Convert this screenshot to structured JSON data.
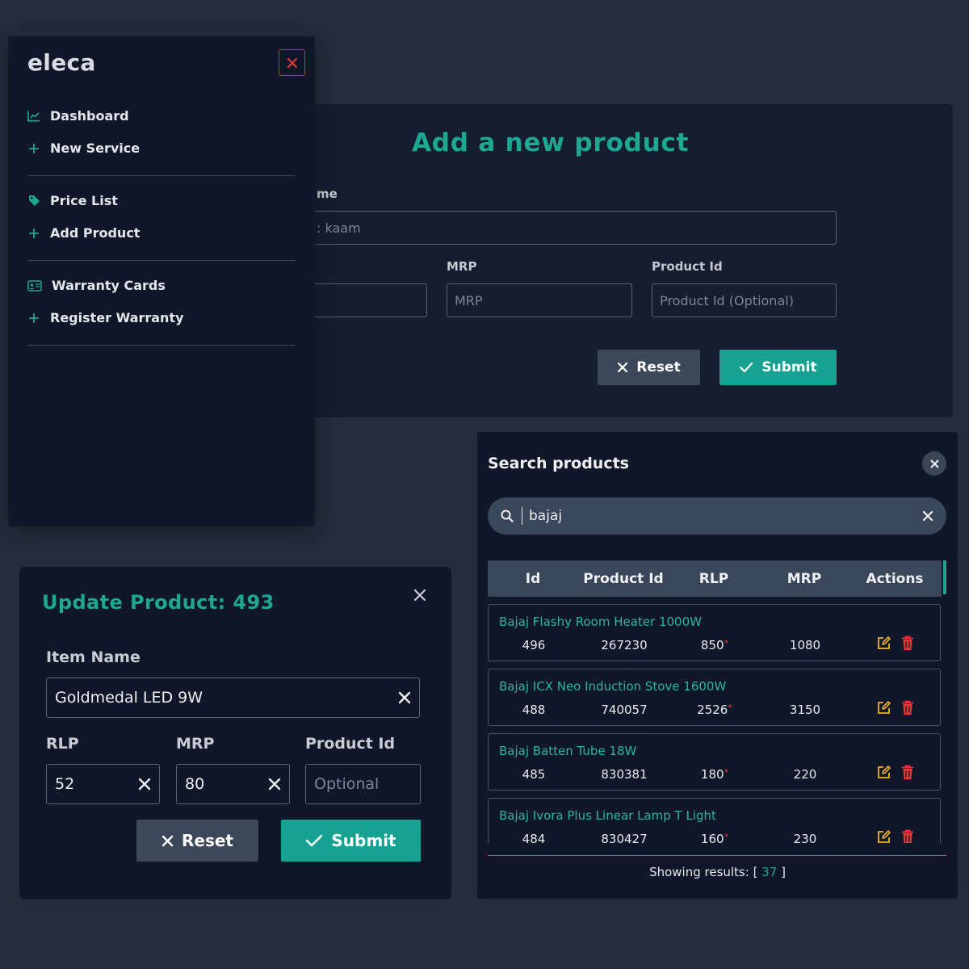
{
  "sidebar": {
    "brand": "eleca",
    "items": [
      {
        "label": "Dashboard",
        "icon": "chart-line-icon"
      },
      {
        "label": "New Service",
        "icon": "plus-icon"
      },
      {
        "label": "Price List",
        "icon": "tag-icon"
      },
      {
        "label": "Add Product",
        "icon": "plus-icon"
      },
      {
        "label": "Warranty Cards",
        "icon": "id-card-icon"
      },
      {
        "label": "Register Warranty",
        "icon": "plus-icon"
      }
    ]
  },
  "add_product": {
    "title": "Add a new product",
    "name_label": "me",
    "name_placeholder": ": kaam",
    "mrp_label": "MRP",
    "mrp_placeholder": "MRP",
    "product_id_label": "Product Id",
    "product_id_placeholder": "Product Id (Optional)",
    "reset_label": "Reset",
    "submit_label": "Submit"
  },
  "update_product": {
    "title": "Update Product: 493",
    "item_name_label": "Item Name",
    "item_name_value": "Goldmedal LED 9W",
    "rlp_label": "RLP",
    "rlp_value": "52",
    "mrp_label": "MRP",
    "mrp_value": "80",
    "product_id_label": "Product Id",
    "product_id_placeholder": "Optional",
    "reset_label": "Reset",
    "submit_label": "Submit"
  },
  "search": {
    "title": "Search products",
    "query": "bajaj",
    "columns": [
      "Id",
      "Product Id",
      "RLP",
      "MRP",
      "Actions"
    ],
    "rows": [
      {
        "name": "Bajaj Flashy Room Heater 1000W",
        "id": "496",
        "product_id": "267230",
        "rlp": "850",
        "mrp": "1080"
      },
      {
        "name": "Bajaj ICX Neo Induction Stove 1600W",
        "id": "488",
        "product_id": "740057",
        "rlp": "2526",
        "mrp": "3150"
      },
      {
        "name": "Bajaj Batten Tube 18W",
        "id": "485",
        "product_id": "830381",
        "rlp": "180",
        "mrp": "220"
      },
      {
        "name": "Bajaj Ivora Plus Linear Lamp T Light",
        "id": "484",
        "product_id": "830427",
        "rlp": "160",
        "mrp": "230"
      }
    ],
    "required_marker": "*",
    "results_prefix": "Showing results: [",
    "results_count": "37",
    "results_suffix": "]"
  },
  "colors": {
    "accent": "#1ea892",
    "danger": "#e03a3a",
    "edit": "#f0b42a",
    "panel": "#0f1729",
    "background": "#232d3b"
  }
}
